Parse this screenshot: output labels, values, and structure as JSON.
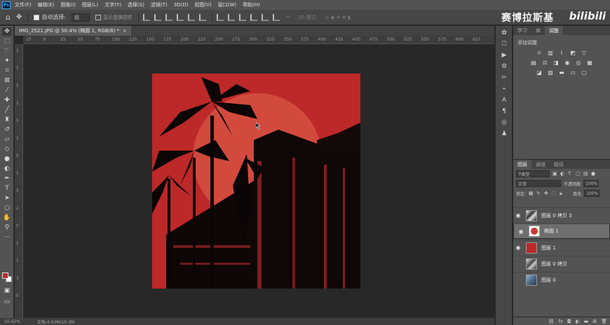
{
  "app": {
    "logo": "Ps"
  },
  "menu": [
    "文件(F)",
    "编辑(E)",
    "图像(I)",
    "图层(L)",
    "文字(Y)",
    "选择(S)",
    "滤镜(T)",
    "3D(D)",
    "视图(V)",
    "窗口(W)",
    "帮助(H)"
  ],
  "options": {
    "auto_select_label": "自动选择:",
    "auto_select_value": "组",
    "show_transform_label": "显示变换控件",
    "mode_3d_label": "3D 模式:",
    "more": "···"
  },
  "watermark": {
    "brand": "赛博拉斯基",
    "site": "bilibili"
  },
  "document": {
    "tab_title": "IMG_2521.JPG @ 50.4% (椭圆 1, RGB/8) *",
    "close": "×",
    "zoom": "50.42%",
    "doc_info": "文档:4.93M/10.3M"
  },
  "ruler": {
    "top": [
      "25",
      "0",
      "25",
      "50",
      "75",
      "100",
      "125",
      "150",
      "175",
      "200",
      "225",
      "250",
      "275",
      "300",
      "325",
      "350",
      "375",
      "400",
      "425",
      "450",
      "475",
      "500",
      "525",
      "550",
      "575",
      "600",
      "625"
    ],
    "left": [
      "2",
      "5",
      "5",
      "1",
      "5",
      "1",
      "0",
      "1",
      "5",
      "2",
      "0",
      "2",
      "5",
      "3",
      "0"
    ]
  },
  "panels": {
    "top_tabs": [
      "学习",
      "库",
      "调整"
    ],
    "active_top_tab": "调整",
    "adjust_title": "添加调整",
    "layers_tabs": [
      "图层",
      "通道",
      "路径"
    ],
    "active_layers_tab": "图层",
    "filter_label": "类型",
    "blend_mode": "正常",
    "opacity_label": "不透明度:",
    "opacity_value": "100%",
    "lock_label": "锁定:",
    "fill_label": "填充:",
    "fill_value": "100%"
  },
  "layers": [
    {
      "name": "图层 0 拷贝 3",
      "visible": true,
      "selected": false,
      "thumb": "photo"
    },
    {
      "name": "椭圆 1",
      "visible": true,
      "selected": true,
      "thumb": "ellipse"
    },
    {
      "name": "图层 1",
      "visible": true,
      "selected": false,
      "thumb": "red"
    },
    {
      "name": "图层 0 拷贝",
      "visible": false,
      "selected": false,
      "thumb": "photo"
    },
    {
      "name": "图层 0",
      "visible": false,
      "selected": false,
      "thumb": "photo-blue"
    }
  ],
  "colors": {
    "foreground": "#c42a2a",
    "background": "#ffffff",
    "canvas_red": "#bd2828",
    "circle_red": "#d24a3e"
  }
}
